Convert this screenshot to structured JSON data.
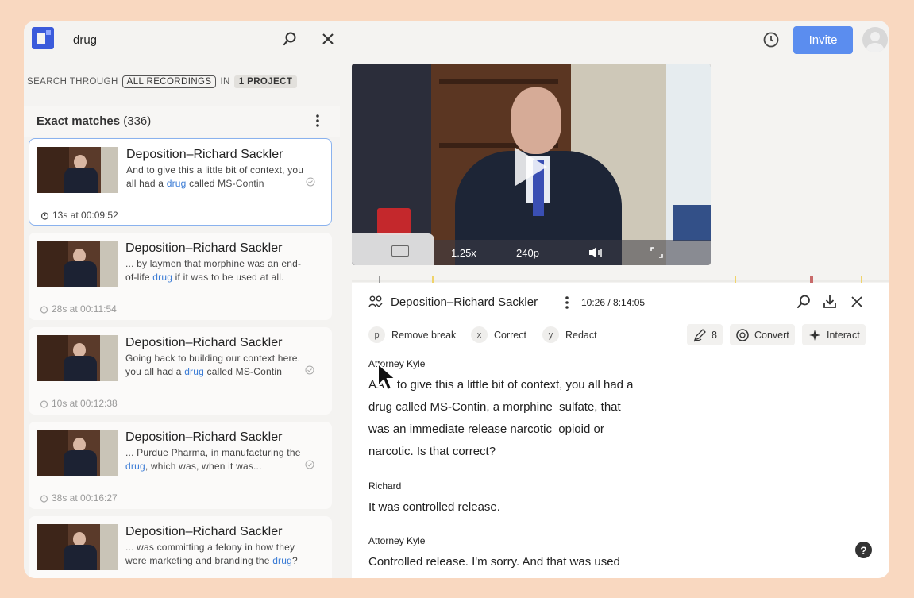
{
  "search": {
    "query": "drug"
  },
  "header": {
    "invite_label": "Invite"
  },
  "scope": {
    "prefix": "SEARCH THROUGH",
    "recordings": "ALL RECORDINGS",
    "in": "IN",
    "project": "1 PROJECT"
  },
  "matches": {
    "title": "Exact matches",
    "count": "(336)"
  },
  "results": [
    {
      "title": "Deposition–Richard Sackler",
      "pre": "And to give this a little bit of context, you all had a ",
      "hl": "drug",
      "post": " called MS-Contin",
      "time": "13s at 00:09:52"
    },
    {
      "title": "Deposition–Richard Sackler",
      "pre": "... by laymen that morphine was an end-of-life ",
      "hl": "drug",
      "post": " if it was to be used at all.",
      "time": "28s at 00:11:54"
    },
    {
      "title": "Deposition–Richard Sackler",
      "pre": "Going back to building our context here. you all had a ",
      "hl": "drug",
      "post": " called MS-Contin",
      "time": "10s at 00:12:38"
    },
    {
      "title": "Deposition–Richard Sackler",
      "pre": "... Purdue Pharma, in manufacturing the ",
      "hl": "drug",
      "post": ", which was, when it was...",
      "time": "38s at 00:16:27"
    },
    {
      "title": "Deposition–Richard Sackler",
      "pre": "... was committing a felony in how they were marketing and branding the ",
      "hl": "drug",
      "post": "?",
      "time": ""
    }
  ],
  "video": {
    "speed": "1.25x",
    "quality": "240p"
  },
  "transcript": {
    "title": "Deposition–Richard Sackler",
    "time": "10:26 / 8:14:05",
    "tools": [
      {
        "key": "p",
        "label": "Remove break"
      },
      {
        "key": "x",
        "label": "Correct"
      },
      {
        "key": "y",
        "label": "Redact"
      }
    ],
    "edits_count": "8",
    "convert_label": "Convert",
    "interact_label": "Interact",
    "blocks": [
      {
        "speaker": "Attorney Kyle",
        "lines": [
          "AA    to give this a little bit of context, you all had a",
          "drug called MS-Contin, a morphine  sulfate, that",
          "was an immediate release narcotic  opioid or",
          "narcotic. Is that correct?"
        ]
      },
      {
        "speaker": "Richard",
        "lines": [
          "It was controlled release."
        ]
      },
      {
        "speaker": "Attorney Kyle",
        "lines": [
          "Controlled release. I'm sorry. And that was used"
        ]
      }
    ]
  },
  "help_label": "?",
  "colors": {
    "accent": "#5b8def",
    "highlight": "#3a7bd5",
    "background": "#f9d8c0"
  }
}
